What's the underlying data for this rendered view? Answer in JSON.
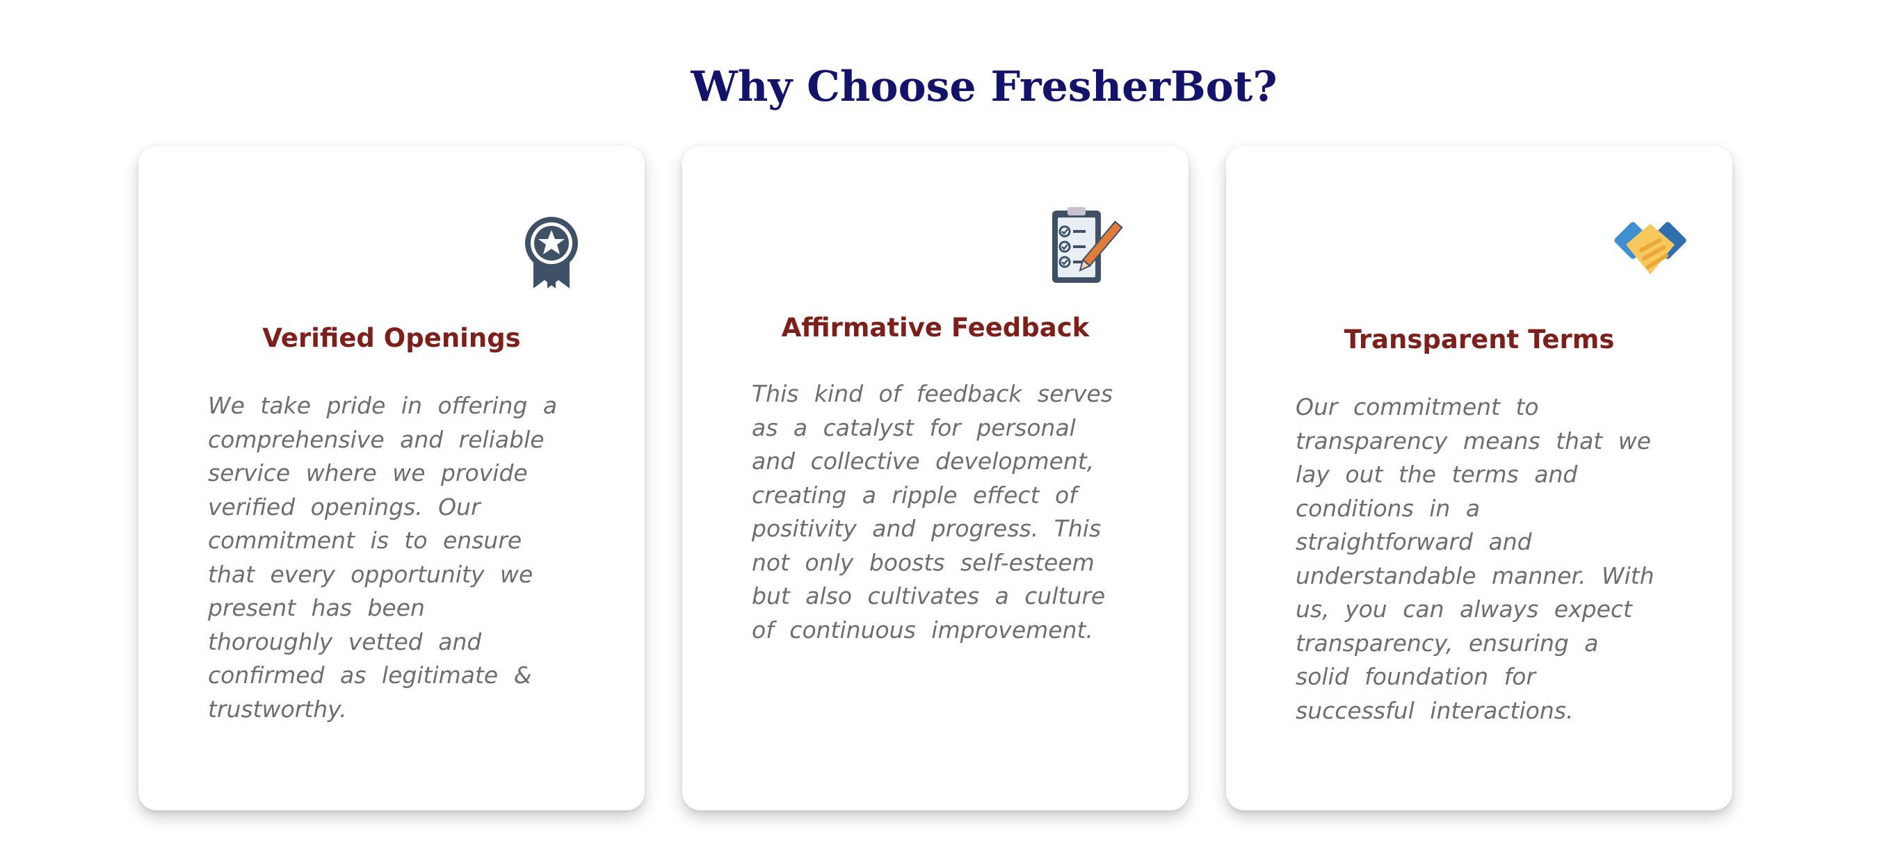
{
  "section": {
    "title": "Why Choose FresherBot?"
  },
  "features": [
    {
      "icon": "award-badge-icon",
      "heading": "Verified Openings",
      "description": "We take pride in offering a comprehensive and reliable service where we provide verified openings. Our commitment is to ensure that every opportunity we present has been thoroughly vetted and confirmed as legitimate & trustworthy."
    },
    {
      "icon": "clipboard-checklist-icon",
      "heading": "Affirmative Feedback",
      "description": "This kind of feedback serves as a catalyst for personal and collective development, creating a ripple effect of positivity and progress. This not only boosts self-esteem but also cultivates a culture of continuous improvement."
    },
    {
      "icon": "handshake-icon",
      "heading": "Transparent Terms",
      "description": "Our commitment to transparency means that we lay out the terms and conditions in a straightforward and understandable manner. With us, you can always expect transparency, ensuring a solid foundation for successful interactions."
    }
  ],
  "colors": {
    "title": "#13136b",
    "heading": "#7d1f1b",
    "body_text": "#6e6e6e",
    "icon_slate": "#3f5166",
    "icon_blue": "#3f8fd1",
    "icon_yellow": "#f7c95c",
    "icon_orange": "#e07b3a"
  }
}
